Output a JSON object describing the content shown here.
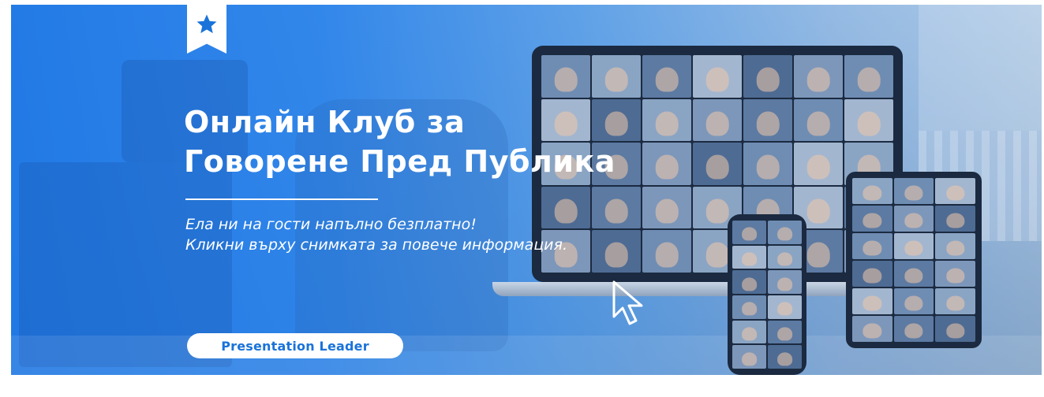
{
  "banner": {
    "title_line1": "Онлайн Клуб за",
    "title_line2": "Говорене Пред Публика",
    "subtitle_line1": "Ела ни на гости напълно безплатно!",
    "subtitle_line2": "Кликни върху снимката за повече информация.",
    "brand_label": "Presentation Leader",
    "bookmark_icon": "star-icon",
    "cursor_icon": "mouse-pointer-icon"
  },
  "colors": {
    "accent": "#1a73d9",
    "overlay": "#1e78e6",
    "text": "#ffffff"
  }
}
